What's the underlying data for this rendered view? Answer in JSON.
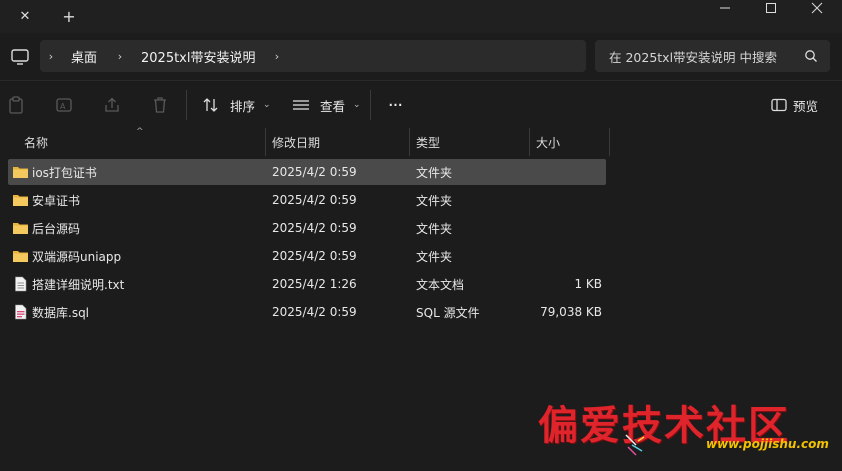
{
  "titlebar": {
    "close_glyph": "✕",
    "new_tab_glyph": "+",
    "minimize_glyph": "—",
    "restore_glyph": "☐",
    "close_window_glyph": "✕"
  },
  "address": {
    "crumbs": [
      "桌面",
      "2025txl带安装说明"
    ],
    "separator": "›",
    "search_placeholder": "在 2025txl带安装说明 中搜索"
  },
  "toolbar": {
    "sort_label": "排序",
    "view_label": "查看",
    "more_label": "···",
    "preview_label": "预览",
    "chevron": "⌄"
  },
  "columns": {
    "name": "名称",
    "modified": "修改日期",
    "type": "类型",
    "size": "大小",
    "sort_caret": "^"
  },
  "files": [
    {
      "name": "ios打包证书",
      "modified": "2025/4/2 0:59",
      "type": "文件夹",
      "size": "",
      "icon": "folder-icon",
      "selected": true
    },
    {
      "name": "安卓证书",
      "modified": "2025/4/2 0:59",
      "type": "文件夹",
      "size": "",
      "icon": "folder-icon",
      "selected": false
    },
    {
      "name": "后台源码",
      "modified": "2025/4/2 0:59",
      "type": "文件夹",
      "size": "",
      "icon": "folder-icon",
      "selected": false
    },
    {
      "name": "双端源码uniapp",
      "modified": "2025/4/2 0:59",
      "type": "文件夹",
      "size": "",
      "icon": "folder-icon",
      "selected": false
    },
    {
      "name": "搭建详细说明.txt",
      "modified": "2025/4/2 1:26",
      "type": "文本文档",
      "size": "1 KB",
      "icon": "text-file-icon",
      "selected": false
    },
    {
      "name": "数据库.sql",
      "modified": "2025/4/2 0:59",
      "type": "SQL 源文件",
      "size": "79,038 KB",
      "icon": "sql-file-icon",
      "selected": false
    }
  ],
  "watermark": {
    "title": "偏爱技术社区",
    "url": "www.pojjishu.com"
  },
  "colors": {
    "background": "#1c1c1c",
    "selected_row": "#4a4a4a",
    "folder": "#f4c95d",
    "watermark_red": "#e0242b",
    "watermark_yellow": "#f2c200"
  }
}
